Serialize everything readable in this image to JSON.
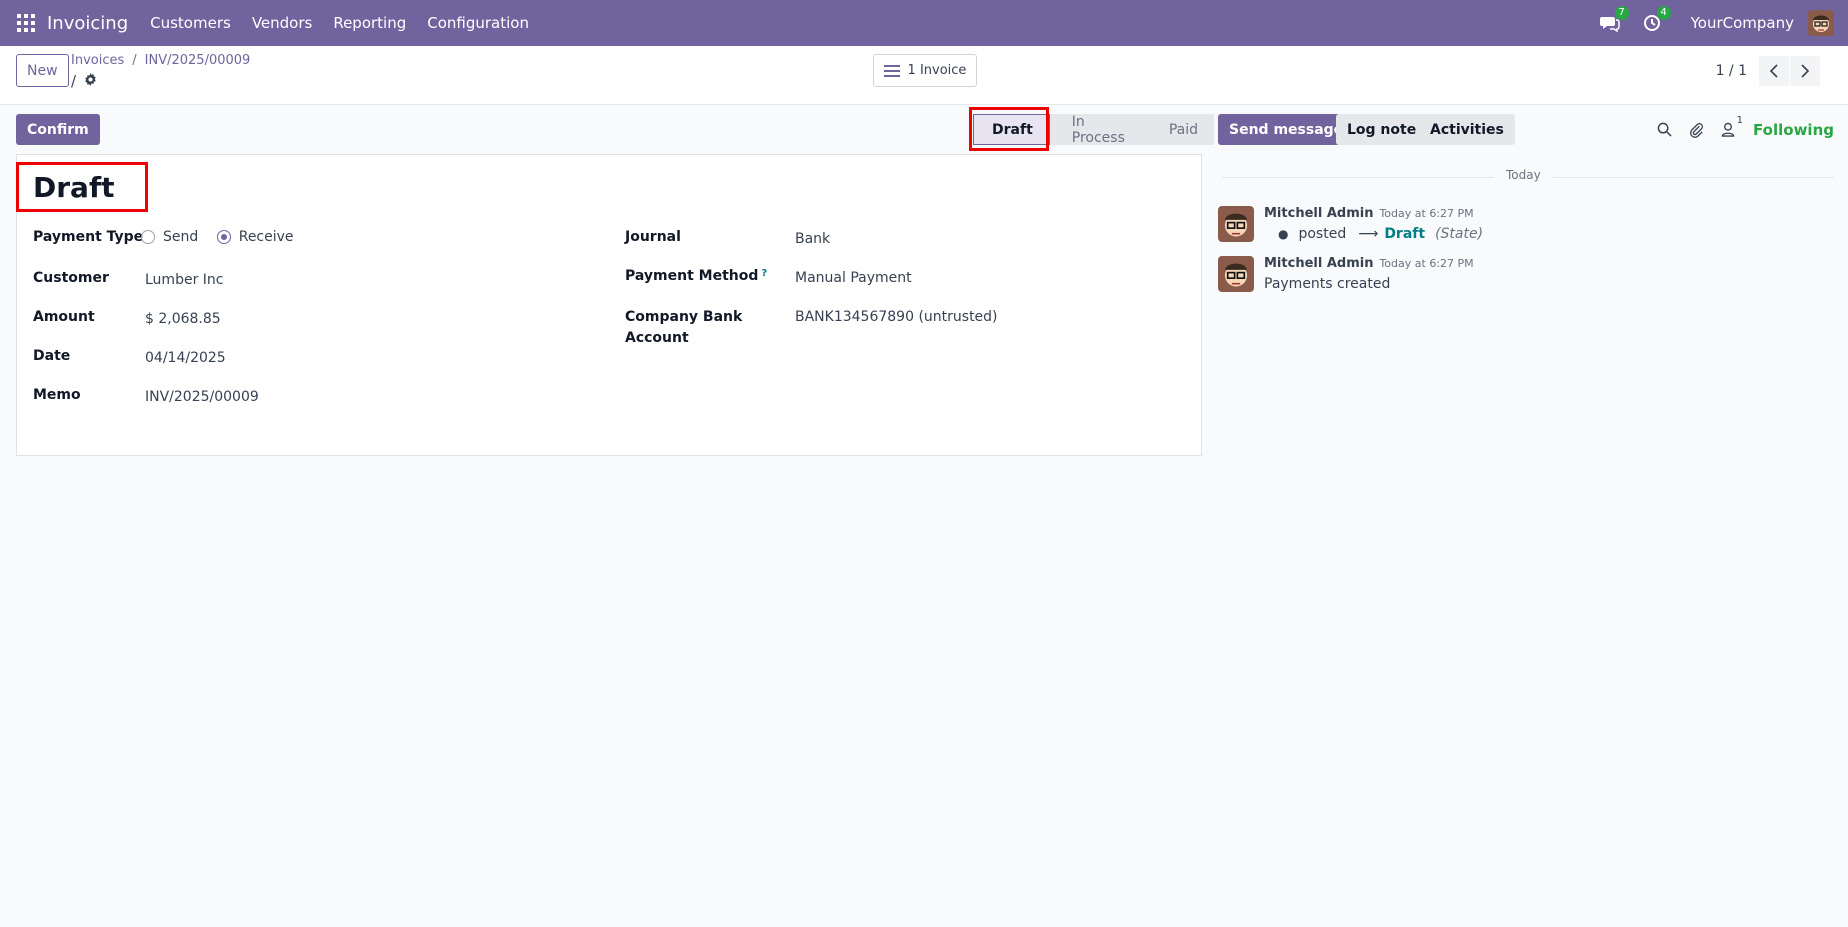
{
  "navbar": {
    "brand": "Invoicing",
    "menu": [
      "Customers",
      "Vendors",
      "Reporting",
      "Configuration"
    ],
    "messages_badge": "7",
    "activities_badge": "4",
    "company": "YourCompany"
  },
  "control": {
    "new_label": "New",
    "breadcrumb": [
      "Invoices",
      "INV/2025/00009"
    ],
    "current_sep": "/",
    "smart_button": "1 Invoice",
    "pager": "1 / 1"
  },
  "form": {
    "confirm_label": "Confirm",
    "status_steps": [
      "Draft",
      "In Process",
      "Paid"
    ],
    "active_status": "Draft",
    "title": "Draft",
    "payment_type_label": "Payment Type",
    "payment_type_options": [
      "Send",
      "Receive"
    ],
    "payment_type_selected": "Receive",
    "customer_label": "Customer",
    "customer": "Lumber Inc",
    "amount_label": "Amount",
    "amount": "$ 2,068.85",
    "date_label": "Date",
    "date": "04/14/2025",
    "memo_label": "Memo",
    "memo": "INV/2025/00009",
    "journal_label": "Journal",
    "journal": "Bank",
    "payment_method_label": "Payment Method",
    "payment_method_help": "?",
    "payment_method": "Manual Payment",
    "bank_account_label_line1": "Company Bank",
    "bank_account_label_line2": "Account",
    "bank_account": "BANK134567890 (untrusted)"
  },
  "chatter": {
    "send_message": "Send message",
    "log_note": "Log note",
    "activities": "Activities",
    "followers_count": "1",
    "following": "Following",
    "date_separator": "Today",
    "messages": [
      {
        "author": "Mitchell Admin",
        "time": "Today at 6:27 PM",
        "tracking_old": "posted",
        "tracking_new": "Draft",
        "tracking_field": "(State)"
      },
      {
        "author": "Mitchell Admin",
        "time": "Today at 6:27 PM",
        "body": "Payments created"
      }
    ]
  },
  "colors": {
    "brand": "#71639e",
    "highlight": "#ee0000",
    "following": "#28a745",
    "link": "#017e84"
  }
}
